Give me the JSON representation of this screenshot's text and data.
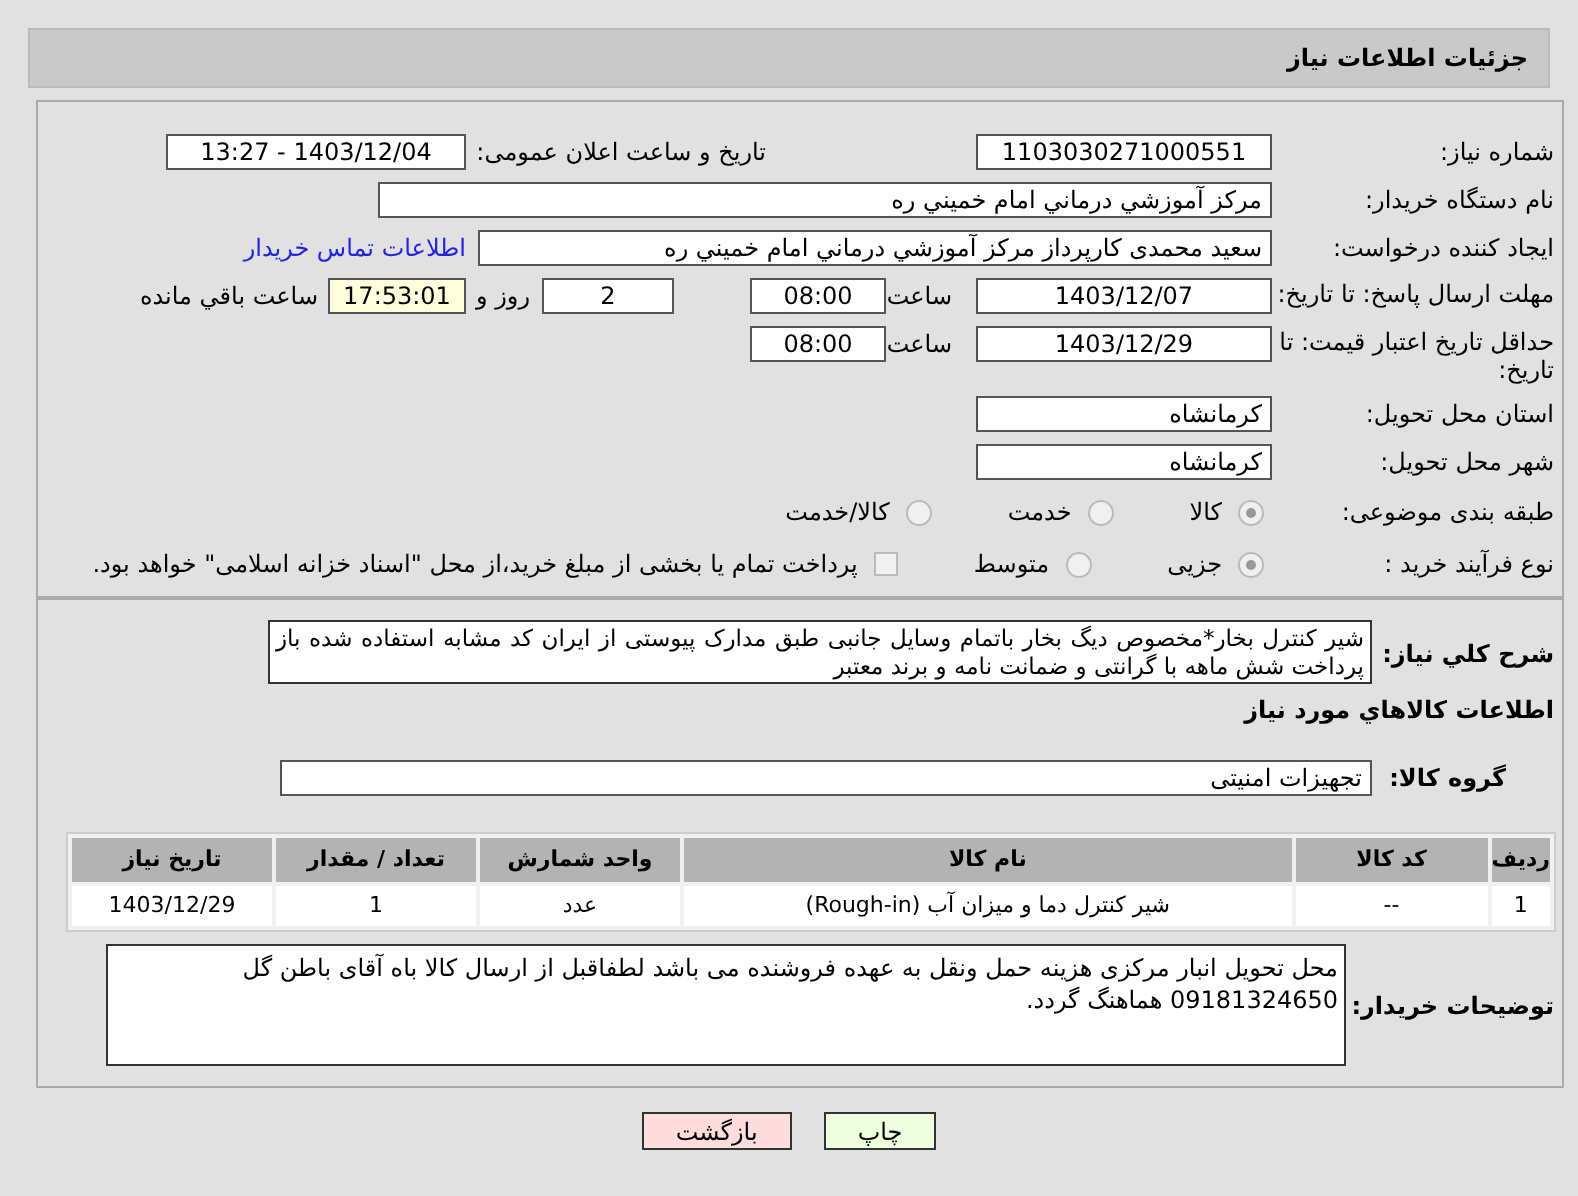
{
  "header": {
    "title": "جزئیات اطلاعات نیاز"
  },
  "need_number": {
    "label": "شماره نیاز:",
    "value": "1103030271000551"
  },
  "announce": {
    "label": "تاریخ و ساعت اعلان عمومی:",
    "value": "1403/12/04 - 13:27"
  },
  "buyer_org": {
    "label": "نام دستگاه خریدار:",
    "value": "مرکز آموزشي درماني امام خميني ره"
  },
  "requester": {
    "label": "ایجاد کننده درخواست:",
    "value": "سعید محمدی کارپرداز مرکز آموزشي درماني امام خميني ره",
    "link": "اطلاعات تماس خریدار"
  },
  "deadline": {
    "label": "مهلت ارسال پاسخ: تا تاریخ:",
    "date": "1403/12/07",
    "time_label": "ساعت",
    "time": "08:00",
    "days": "2",
    "days_label": "روز و",
    "remaining": "17:53:01",
    "remaining_label": "ساعت باقي مانده"
  },
  "validity": {
    "label": "حداقل تاریخ اعتبار قیمت: تا تاریخ:",
    "date": "1403/12/29",
    "time_label": "ساعت",
    "time": "08:00"
  },
  "province": {
    "label": "استان محل تحویل:",
    "value": "کرمانشاه"
  },
  "city": {
    "label": "شهر محل تحویل:",
    "value": "کرمانشاه"
  },
  "category": {
    "label": "طبقه بندی موضوعی:",
    "options": [
      {
        "label": "کالا",
        "selected": true
      },
      {
        "label": "خدمت",
        "selected": false
      },
      {
        "label": "کالا/خدمت",
        "selected": false
      }
    ]
  },
  "process": {
    "label": "نوع فرآیند خرید :",
    "options": [
      {
        "label": "جزیی",
        "selected": true
      },
      {
        "label": "متوسط",
        "selected": false
      }
    ],
    "payment": {
      "label": "پرداخت تمام یا بخشی از مبلغ خرید،از محل \"اسناد خزانه اسلامی\" خواهد بود.",
      "checked": false
    }
  },
  "description": {
    "label": "شرح کلي نیاز:",
    "value": "شیر کنترل بخار*مخصوص دیگ بخار باتمام وسایل جانبی طبق مدارک پیوستی از ایران کد مشابه استفاده شده باز پرداخت شش ماهه با گرانتی و ضمانت نامه و برند معتبر"
  },
  "goods_heading": "اطلاعات کالاهاي مورد نیاز",
  "goods_group": {
    "label": "گروه کالا:",
    "value": "تجهیزات امنیتی"
  },
  "table": {
    "columns": [
      "ردیف",
      "کد کالا",
      "نام کالا",
      "واحد شمارش",
      "تعداد / مقدار",
      "تاریخ نیاز"
    ],
    "rows": [
      [
        "1",
        "--",
        "شیر کنترل دما و میزان آب (Rough-in)",
        "عدد",
        "1",
        "1403/12/29"
      ]
    ]
  },
  "buyer_notes": {
    "label": "توضیحات خریدار:",
    "value": "محل تحویل انبار مرکزی هزینه حمل ونقل به عهده فروشنده می باشد لطفاقبل از ارسال کالا باه آقای باطن گل 09181324650 هماهنگ گردد."
  },
  "buttons": [
    {
      "label": "چاپ",
      "kind": "print"
    },
    {
      "label": "بازگشت",
      "kind": "back"
    }
  ]
}
